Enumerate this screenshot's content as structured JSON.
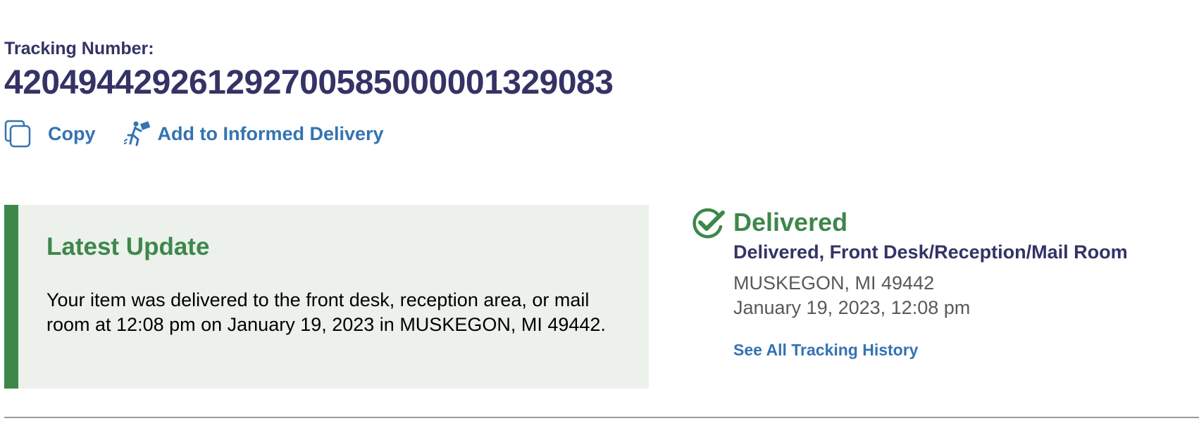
{
  "tracking": {
    "label": "Tracking Number:",
    "number": "420494429261292700585000001329083"
  },
  "actions": {
    "copy_label": "Copy",
    "informed_label": "Add to Informed Delivery"
  },
  "latest_update": {
    "title": "Latest Update",
    "body": "Your item was delivered to the front desk, reception area, or mail room at 12:08 pm on January 19, 2023 in MUSKEGON, MI 49442."
  },
  "status": {
    "heading": "Delivered",
    "detail": "Delivered, Front Desk/Reception/Mail Room",
    "location": "MUSKEGON, MI 49442",
    "datetime": "January 19, 2023, 12:08 pm",
    "history_link": "See All Tracking History",
    "icon": "check-circle-icon"
  },
  "colors": {
    "navy": "#333366",
    "link_blue": "#3573b1",
    "success_green": "#3d874b",
    "panel_bg": "#ecf1ec",
    "muted_text": "#595959"
  }
}
